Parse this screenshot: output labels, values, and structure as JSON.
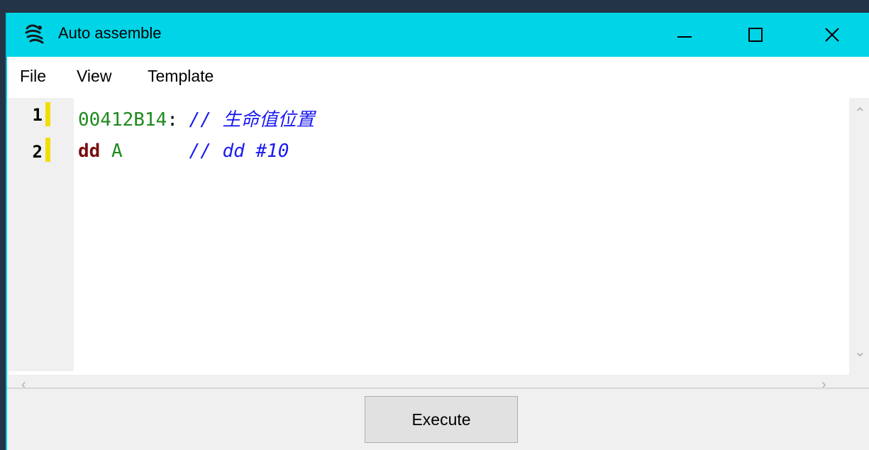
{
  "window": {
    "title": "Auto assemble",
    "app_icon": "cheat-engine-icon",
    "controls": {
      "minimize_icon": "minimize-icon",
      "maximize_icon": "maximize-icon",
      "close_icon": "close-icon"
    }
  },
  "menu": {
    "items": [
      "File",
      "View",
      "Template"
    ]
  },
  "editor": {
    "lines": [
      {
        "number": "1",
        "address": "00412B14",
        "colon": ":",
        "comment": "// 生命值位置"
      },
      {
        "number": "2",
        "keyword": "dd",
        "operand": "A",
        "spacing": "      ",
        "comment": "// dd #10"
      }
    ]
  },
  "footer": {
    "execute_label": "Execute"
  },
  "colors": {
    "titlebar": "#00d5e8",
    "address": "#1e8a1e",
    "comment": "#1a1af0",
    "keyword": "#7a0e0e",
    "change_marker": "#f0de00"
  }
}
